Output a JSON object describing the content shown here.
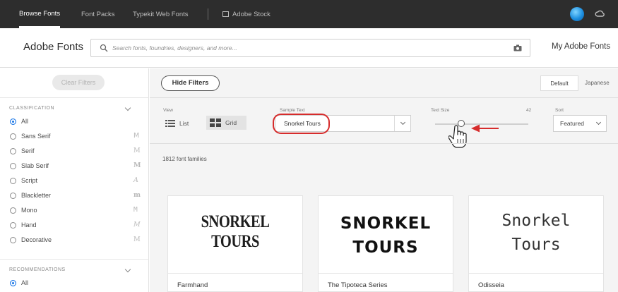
{
  "topbar": {
    "tabs": [
      {
        "label": "Browse Fonts",
        "active": true
      },
      {
        "label": "Font Packs",
        "active": false
      },
      {
        "label": "Typekit Web Fonts",
        "active": false
      },
      {
        "label": "Adobe Stock",
        "active": false
      }
    ],
    "icons": [
      "stock-icon",
      "avatar",
      "creative-cloud-icon"
    ]
  },
  "header": {
    "brand": "Adobe Fonts",
    "search_placeholder": "Search fonts, foundries, designers, and more...",
    "my_fonts": "My Adobe Fonts"
  },
  "sidebar": {
    "clear_filters": "Clear Filters",
    "classification": {
      "title": "CLASSIFICATION",
      "items": [
        {
          "label": "All",
          "glyph": "",
          "selected": true
        },
        {
          "label": "Sans Serif",
          "glyph": "M",
          "selected": false
        },
        {
          "label": "Serif",
          "glyph": "M",
          "selected": false
        },
        {
          "label": "Slab Serif",
          "glyph": "M",
          "selected": false
        },
        {
          "label": "Script",
          "glyph": "A",
          "selected": false
        },
        {
          "label": "Blackletter",
          "glyph": "m",
          "selected": false
        },
        {
          "label": "Mono",
          "glyph": "M",
          "selected": false
        },
        {
          "label": "Hand",
          "glyph": "M",
          "selected": false
        },
        {
          "label": "Decorative",
          "glyph": "M",
          "selected": false
        }
      ]
    },
    "recommendations": {
      "title": "RECOMMENDATIONS",
      "items": [
        {
          "label": "All",
          "selected": true
        }
      ]
    }
  },
  "main": {
    "hide_filters": "Hide Filters",
    "languages": [
      "Default",
      "Japanese"
    ],
    "view": {
      "label": "View",
      "list": "List",
      "grid": "Grid",
      "selected": "Grid"
    },
    "sample_text": {
      "label": "Sample Text",
      "value": "Snorkel Tours"
    },
    "text_size": {
      "label": "Text Size",
      "value": "42"
    },
    "sort": {
      "label": "Sort",
      "value": "Featured"
    },
    "count": "1812 font families",
    "cards": [
      {
        "name": "Farmhand",
        "preview": "SNORKEL TOURS"
      },
      {
        "name": "The Tipoteca Series",
        "preview_line1": "SNORKEL",
        "preview_line2": "TOURS"
      },
      {
        "name": "Odisseia",
        "preview_line1": "Snorkel",
        "preview_line2": "Tours"
      }
    ]
  },
  "colors": {
    "accent": "#1473e6",
    "topbar_bg": "#2d2d2d",
    "annotation_red": "#d62c2c"
  }
}
